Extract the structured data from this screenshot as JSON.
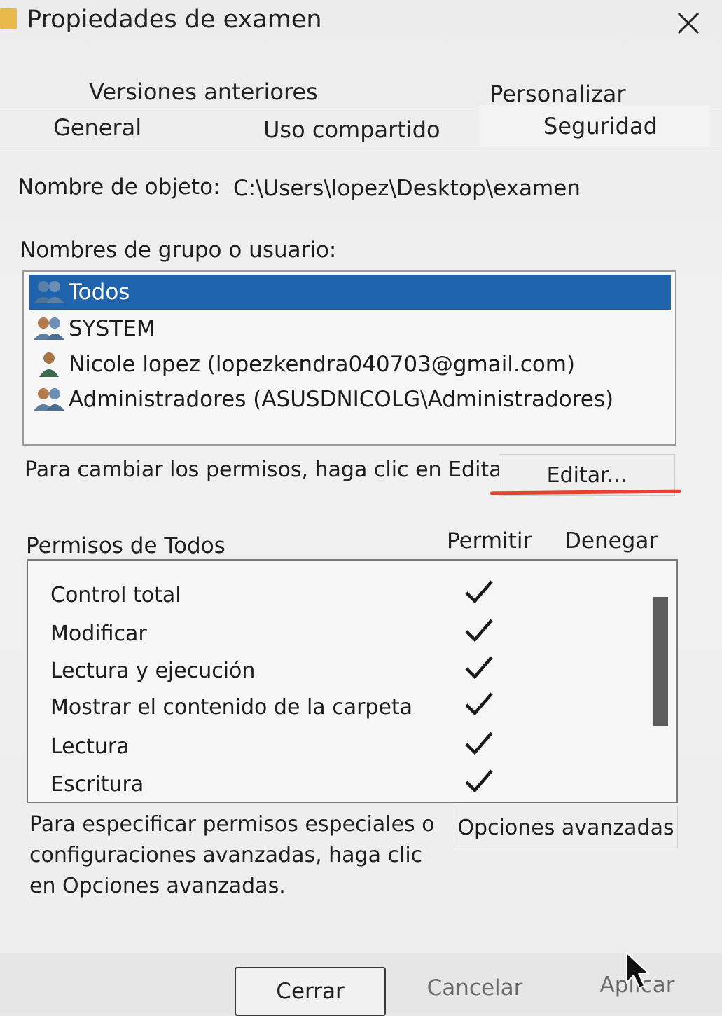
{
  "window": {
    "title": "Propiedades de examen",
    "close_icon": "close-icon"
  },
  "tabs": {
    "row1": [
      "Versiones anteriores",
      "Personalizar"
    ],
    "row2": [
      "General",
      "Uso compartido",
      "Seguridad"
    ],
    "active": "Seguridad"
  },
  "object": {
    "label": "Nombre de objeto:",
    "value": "C:\\Users\\lopez\\Desktop\\examen"
  },
  "groups": {
    "label": "Nombres de grupo o usuario:",
    "items": [
      {
        "name": "Todos",
        "icon": "group-users-icon",
        "selected": true
      },
      {
        "name": "SYSTEM",
        "icon": "group-users-icon",
        "selected": false
      },
      {
        "name": "Nicole lopez (lopezkendra040703@gmail.com)",
        "icon": "single-user-icon",
        "selected": false
      },
      {
        "name": "Administradores (ASUSDNICOLG\\Administradores)",
        "icon": "group-users-icon",
        "selected": false
      }
    ]
  },
  "edit": {
    "hint": "Para cambiar los permisos, haga clic en Editar.",
    "button_label": "Editar..."
  },
  "permissions": {
    "title": "Permisos de Todos",
    "col_allow": "Permitir",
    "col_deny": "Denegar",
    "rows": [
      {
        "name": "Control total",
        "allow": true,
        "deny": false
      },
      {
        "name": "Modificar",
        "allow": true,
        "deny": false
      },
      {
        "name": "Lectura y ejecución",
        "allow": true,
        "deny": false
      },
      {
        "name": "Mostrar el contenido de la carpeta",
        "allow": true,
        "deny": false
      },
      {
        "name": "Lectura",
        "allow": true,
        "deny": false
      },
      {
        "name": "Escritura",
        "allow": true,
        "deny": false
      }
    ]
  },
  "advanced": {
    "hint": "Para especificar permisos especiales o configuraciones avanzadas, haga clic en Opciones avanzadas.",
    "button_label": "Opciones avanzadas"
  },
  "footer": {
    "close_label": "Cerrar",
    "cancel_label": "Cancelar",
    "apply_label": "Aplicar"
  },
  "colors": {
    "selection": "#1f63ad",
    "annotation": "#e8412f"
  }
}
